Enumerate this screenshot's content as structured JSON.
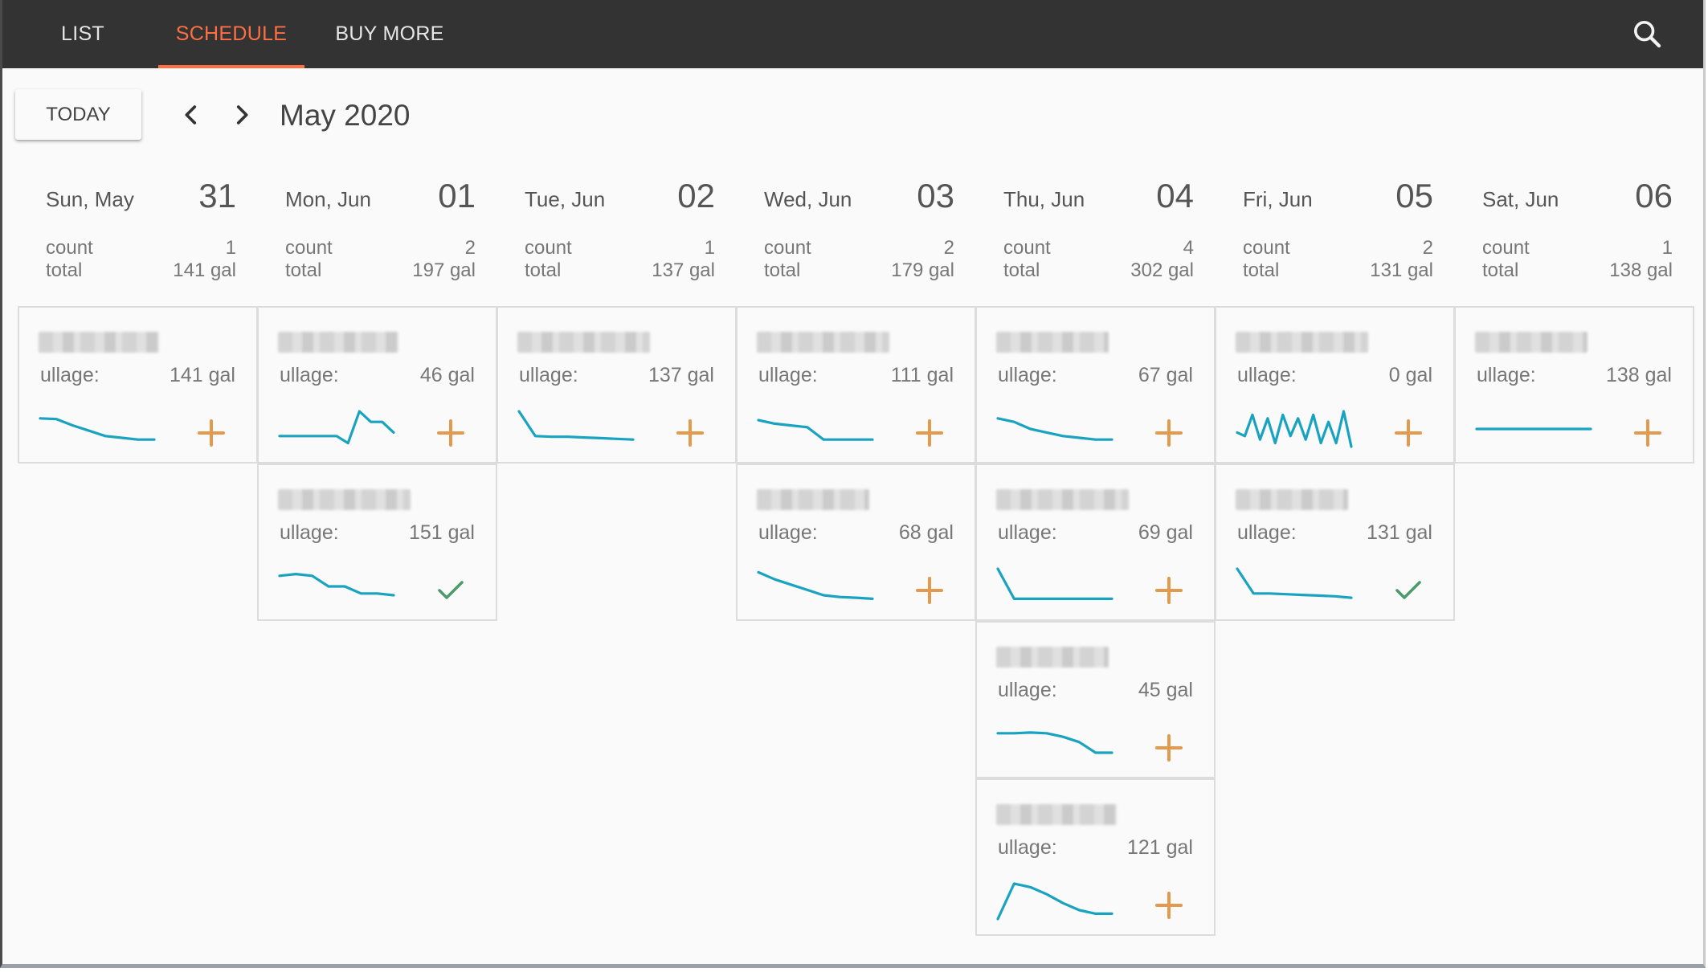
{
  "nav": {
    "tabs": [
      {
        "label": "LIST"
      },
      {
        "label": "SCHEDULE"
      },
      {
        "label": "BUY MORE"
      }
    ],
    "search_icon": "search-icon"
  },
  "toolbar": {
    "today_label": "TODAY",
    "prev_icon": "chevron-left-icon",
    "next_icon": "chevron-right-icon",
    "month_label": "May 2020"
  },
  "labels": {
    "count": "count",
    "total": "total",
    "ullage": "ullage:"
  },
  "colors": {
    "accent": "#ff6f43",
    "sparkline": "#1aa3c0",
    "add": "#e39a4c",
    "check": "#4e9a6a",
    "topbar": "#333333"
  },
  "days": [
    {
      "name": "Sun, May",
      "num": "31",
      "count": "1",
      "total": "141 gal",
      "cards": [
        {
          "ullage": "141 gal",
          "action": "add",
          "trend": [
            0.2,
            0.22,
            0.4,
            0.55,
            0.7,
            0.75,
            0.8,
            0.8
          ]
        }
      ]
    },
    {
      "name": "Mon, Jun",
      "num": "01",
      "count": "2",
      "total": "197 gal",
      "cards": [
        {
          "ullage": "46 gal",
          "action": "add",
          "trend": [
            0.7,
            0.7,
            0.7,
            0.7,
            0.7,
            0.7,
            0.9,
            0.0,
            0.3,
            0.3,
            0.6
          ]
        },
        {
          "ullage": "151 gal",
          "action": "done",
          "trend": [
            0.2,
            0.15,
            0.2,
            0.5,
            0.5,
            0.7,
            0.7,
            0.75
          ]
        }
      ]
    },
    {
      "name": "Tue, Jun",
      "num": "02",
      "count": "1",
      "total": "137 gal",
      "cards": [
        {
          "ullage": "137 gal",
          "action": "add",
          "trend": [
            0.0,
            0.7,
            0.72,
            0.72,
            0.74,
            0.76,
            0.78,
            0.8
          ]
        }
      ]
    },
    {
      "name": "Wed, Jun",
      "num": "03",
      "count": "2",
      "total": "179 gal",
      "cards": [
        {
          "ullage": "111 gal",
          "action": "add",
          "trend": [
            0.25,
            0.35,
            0.4,
            0.45,
            0.8,
            0.8,
            0.8,
            0.8
          ]
        },
        {
          "ullage": "68 gal",
          "action": "add",
          "trend": [
            0.1,
            0.3,
            0.45,
            0.6,
            0.75,
            0.8,
            0.82,
            0.85
          ]
        }
      ]
    },
    {
      "name": "Thu, Jun",
      "num": "04",
      "count": "4",
      "total": "302 gal",
      "cards": [
        {
          "ullage": "67 gal",
          "action": "add",
          "trend": [
            0.2,
            0.3,
            0.5,
            0.6,
            0.7,
            0.75,
            0.8,
            0.8
          ]
        },
        {
          "ullage": "69 gal",
          "action": "add",
          "trend": [
            0.0,
            0.85,
            0.85,
            0.85,
            0.85,
            0.85,
            0.85,
            0.85
          ]
        },
        {
          "ullage": "45 gal",
          "action": "add",
          "trend": [
            0.2,
            0.2,
            0.18,
            0.2,
            0.3,
            0.45,
            0.75,
            0.75
          ]
        },
        {
          "ullage": "121 gal",
          "action": "add",
          "trend": [
            1.0,
            0.0,
            0.1,
            0.3,
            0.55,
            0.75,
            0.85,
            0.85
          ]
        }
      ]
    },
    {
      "name": "Fri, Jun",
      "num": "05",
      "count": "2",
      "total": "131 gal",
      "cards": [
        {
          "ullage": "0 gal",
          "action": "add",
          "trend": [
            0.6,
            0.7,
            0.1,
            0.8,
            0.2,
            0.9,
            0.1,
            0.7,
            0.2,
            0.8,
            0.1,
            0.9,
            0.3,
            0.9,
            0.0,
            1.0
          ]
        },
        {
          "ullage": "131 gal",
          "action": "done",
          "trend": [
            0.0,
            0.7,
            0.7,
            0.72,
            0.74,
            0.76,
            0.78,
            0.82
          ]
        }
      ]
    },
    {
      "name": "Sat, Jun",
      "num": "06",
      "count": "1",
      "total": "138 gal",
      "cards": [
        {
          "ullage": "138 gal",
          "action": "add",
          "trend": [
            0.5,
            0.5,
            0.5,
            0.5,
            0.5,
            0.5,
            0.5,
            0.5
          ]
        }
      ]
    }
  ]
}
